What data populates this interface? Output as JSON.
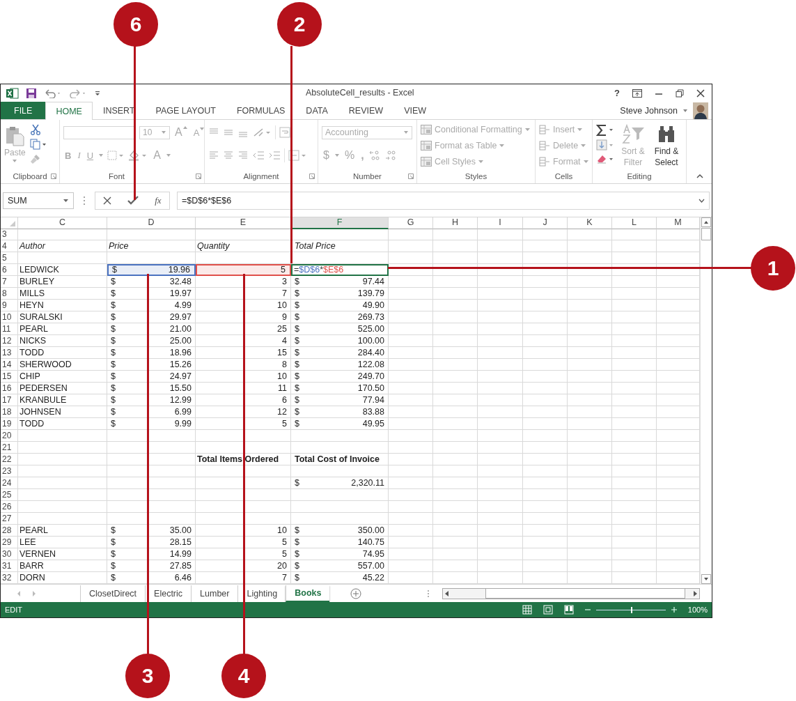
{
  "window": {
    "title": "AbsoluteCell_results - Excel",
    "help": "?"
  },
  "tabs": [
    {
      "label": "FILE",
      "selected": false,
      "kind": "file"
    },
    {
      "label": "HOME",
      "selected": true,
      "kind": "tab"
    },
    {
      "label": "INSERT",
      "selected": false,
      "kind": "tab"
    },
    {
      "label": "PAGE LAYOUT",
      "selected": false,
      "kind": "tab"
    },
    {
      "label": "FORMULAS",
      "selected": false,
      "kind": "tab"
    },
    {
      "label": "DATA",
      "selected": false,
      "kind": "tab"
    },
    {
      "label": "REVIEW",
      "selected": false,
      "kind": "tab"
    },
    {
      "label": "VIEW",
      "selected": false,
      "kind": "tab"
    }
  ],
  "user": {
    "name": "Steve Johnson"
  },
  "ribbon": {
    "groups": [
      {
        "kind": "clipboard",
        "label": "Clipboard",
        "paste": "Paste"
      },
      {
        "kind": "font",
        "label": "Font",
        "size": "10",
        "grow": "A",
        "shrink": "A",
        "bold": "B",
        "italic": "I",
        "underline": "U",
        "font_color": "A"
      },
      {
        "kind": "alignment",
        "label": "Alignment"
      },
      {
        "kind": "number",
        "label": "Number",
        "format": "Accounting",
        "currency": "$",
        "percent": "%",
        "comma": ","
      },
      {
        "kind": "styles",
        "label": "Styles",
        "items": [
          "Conditional Formatting",
          "Format as Table",
          "Cell Styles"
        ]
      },
      {
        "kind": "cells",
        "label": "Cells",
        "items": [
          "Insert",
          "Delete",
          "Format"
        ]
      },
      {
        "kind": "editing",
        "label": "Editing",
        "sort": "Sort & Filter",
        "find": "Find & Select"
      }
    ]
  },
  "formula_bar": {
    "name_box": "SUM",
    "function_label": "fx",
    "formula": "=$D$6*$E$6"
  },
  "columns": [
    {
      "label": "C",
      "selected": false
    },
    {
      "label": "D",
      "selected": false
    },
    {
      "label": "E",
      "selected": false
    },
    {
      "label": "F",
      "selected": true
    },
    {
      "label": "G",
      "selected": false
    },
    {
      "label": "H",
      "selected": false
    },
    {
      "label": "I",
      "selected": false
    },
    {
      "label": "J",
      "selected": false
    },
    {
      "label": "K",
      "selected": false
    },
    {
      "label": "L",
      "selected": false
    },
    {
      "label": "M",
      "selected": false
    }
  ],
  "rows": [
    {
      "num": "3"
    },
    {
      "num": "4",
      "kind": "header",
      "c": "Author",
      "d": "Price",
      "e": "Quantity",
      "f": "Total Price"
    },
    {
      "num": "5"
    },
    {
      "num": "6",
      "kind": "editing",
      "c": "LEDWICK",
      "d": [
        "$",
        "19.96"
      ],
      "e": "5",
      "d_ref": {
        "color": "#4a72c0"
      },
      "e_ref": {
        "color": "#e0504a"
      },
      "formula": [
        {
          "text": "=",
          "color": "#333333"
        },
        {
          "text": "$D$6",
          "color": "#4a72c0"
        },
        {
          "text": "*",
          "color": "#333333"
        },
        {
          "text": "$E$6",
          "color": "#e0504a"
        }
      ]
    },
    {
      "num": "7",
      "c": "BURLEY",
      "d": [
        "$",
        "32.48"
      ],
      "e": "3",
      "f": [
        "$",
        "97.44"
      ]
    },
    {
      "num": "8",
      "c": "MILLS",
      "d": [
        "$",
        "19.97"
      ],
      "e": "7",
      "f": [
        "$",
        "139.79"
      ]
    },
    {
      "num": "9",
      "c": "HEYN",
      "d": [
        "$",
        "4.99"
      ],
      "e": "10",
      "f": [
        "$",
        "49.90"
      ]
    },
    {
      "num": "10",
      "c": "SURALSKI",
      "d": [
        "$",
        "29.97"
      ],
      "e": "9",
      "f": [
        "$",
        "269.73"
      ]
    },
    {
      "num": "11",
      "c": "PEARL",
      "d": [
        "$",
        "21.00"
      ],
      "e": "25",
      "f": [
        "$",
        "525.00"
      ]
    },
    {
      "num": "12",
      "c": "NICKS",
      "d": [
        "$",
        "25.00"
      ],
      "e": "4",
      "f": [
        "$",
        "100.00"
      ]
    },
    {
      "num": "13",
      "c": "TODD",
      "d": [
        "$",
        "18.96"
      ],
      "e": "15",
      "f": [
        "$",
        "284.40"
      ]
    },
    {
      "num": "14",
      "c": "SHERWOOD",
      "d": [
        "$",
        "15.26"
      ],
      "e": "8",
      "f": [
        "$",
        "122.08"
      ]
    },
    {
      "num": "15",
      "c": "CHIP",
      "d": [
        "$",
        "24.97"
      ],
      "e": "10",
      "f": [
        "$",
        "249.70"
      ]
    },
    {
      "num": "16",
      "c": "PEDERSEN",
      "d": [
        "$",
        "15.50"
      ],
      "e": "11",
      "f": [
        "$",
        "170.50"
      ]
    },
    {
      "num": "17",
      "c": "KRANBULE",
      "d": [
        "$",
        "12.99"
      ],
      "e": "6",
      "f": [
        "$",
        "77.94"
      ]
    },
    {
      "num": "18",
      "c": "JOHNSEN",
      "d": [
        "$",
        "6.99"
      ],
      "e": "12",
      "f": [
        "$",
        "83.88"
      ]
    },
    {
      "num": "19",
      "c": "TODD",
      "d": [
        "$",
        "9.99"
      ],
      "e": "5",
      "f": [
        "$",
        "49.95"
      ]
    },
    {
      "num": "20"
    },
    {
      "num": "21"
    },
    {
      "num": "22",
      "kind": "total",
      "e": "Total Items Ordered",
      "f": "Total Cost of Invoice"
    },
    {
      "num": "23"
    },
    {
      "num": "24",
      "f": [
        "$",
        "2,320.11"
      ]
    },
    {
      "num": "25"
    },
    {
      "num": "26"
    },
    {
      "num": "27"
    },
    {
      "num": "28",
      "c": "PEARL",
      "d": [
        "$",
        "35.00"
      ],
      "e": "10",
      "f": [
        "$",
        "350.00"
      ]
    },
    {
      "num": "29",
      "c": "LEE",
      "d": [
        "$",
        "28.15"
      ],
      "e": "5",
      "f": [
        "$",
        "140.75"
      ]
    },
    {
      "num": "30",
      "c": "VERNEN",
      "d": [
        "$",
        "14.99"
      ],
      "e": "5",
      "f": [
        "$",
        "74.95"
      ]
    },
    {
      "num": "31",
      "c": "BARR",
      "d": [
        "$",
        "27.85"
      ],
      "e": "20",
      "f": [
        "$",
        "557.00"
      ]
    },
    {
      "num": "32",
      "c": "DORN",
      "d": [
        "$",
        "6.46"
      ],
      "e": "7",
      "f": [
        "$",
        "45.22"
      ]
    }
  ],
  "sheets": [
    {
      "label": "ClosetDirect",
      "selected": false
    },
    {
      "label": "Electric",
      "selected": false
    },
    {
      "label": "Lumber",
      "selected": false
    },
    {
      "label": "Lighting",
      "selected": false
    },
    {
      "label": "Books",
      "selected": true
    }
  ],
  "status_bar": {
    "mode": "EDIT",
    "zoom": {
      "level": 0.5,
      "reading": "100%"
    }
  },
  "callouts": [
    {
      "number": "6"
    },
    {
      "number": "2"
    },
    {
      "number": "1"
    },
    {
      "number": "3"
    },
    {
      "number": "4"
    }
  ]
}
